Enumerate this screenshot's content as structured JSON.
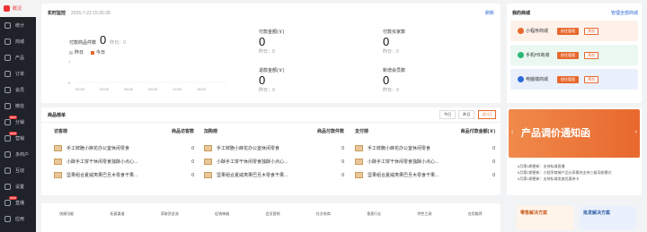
{
  "sidebar": {
    "items": [
      {
        "label": "概况",
        "active": true
      },
      {
        "label": "统计"
      },
      {
        "label": "商城"
      },
      {
        "label": "产品"
      },
      {
        "label": "订单"
      },
      {
        "label": "会员"
      },
      {
        "label": "微信"
      },
      {
        "label": "分销",
        "badge": "NEW"
      },
      {
        "label": "营销",
        "badge": "NEW"
      },
      {
        "label": "多商户"
      },
      {
        "label": "互动"
      },
      {
        "label": "设置"
      },
      {
        "label": "直播",
        "badge": "NEW"
      },
      {
        "label": "应用"
      }
    ]
  },
  "monitor": {
    "title": "实时监控",
    "timestamp": "2025-7-23 15:25:28",
    "refresh": "刷新",
    "paid_products_label": "付款商品件数",
    "paid_products_value": "0",
    "yesterday_label": "昨日：0",
    "legend_yesterday": "昨日",
    "legend_today": "今日",
    "y_ticks": [
      "1",
      "0"
    ],
    "x_ticks": [
      "00:00",
      "03:00",
      "06:00",
      "09:00",
      "12:00",
      "15:00"
    ],
    "stats": [
      {
        "label": "付款金额(￥)",
        "value": "0",
        "sub": "昨日：0"
      },
      {
        "label": "付款买家数",
        "value": "0",
        "sub": "昨日：0"
      },
      {
        "label": "退款金额(￥)",
        "value": "0",
        "sub": "昨日：0"
      },
      {
        "label": "新增会员数",
        "value": "0",
        "sub": "昨日：0"
      }
    ]
  },
  "ranking": {
    "title": "商品榜单",
    "filters": [
      "今日",
      "昨日",
      "近7日"
    ],
    "active_filter": "近7日",
    "columns": [
      {
        "title": "访客榜",
        "metric": "商品访客数",
        "rows": [
          {
            "name": "手工鲜脆小麻花办公室休闲零食",
            "value": "0"
          },
          {
            "name": "小酥手工饼干休闲零食独酥小点心...",
            "value": "0"
          },
          {
            "name": "坚果组合夏威夷果巴旦木零食干果...",
            "value": "0"
          }
        ]
      },
      {
        "title": "加购榜",
        "metric": "商品付款件数",
        "rows": [
          {
            "name": "手工鲜脆小麻花办公室休闲零食",
            "value": "0"
          },
          {
            "name": "小酥手工饼干休闲零食独酥小点心...",
            "value": "0"
          },
          {
            "name": "坚果组合夏威夷果巴旦木零食干果...",
            "value": "0"
          }
        ]
      },
      {
        "title": "支付榜",
        "metric": "商品付款金额(￥)",
        "rows": [
          {
            "name": "手工鲜脆小麻花办公室休闲零食",
            "value": "0"
          },
          {
            "name": "小酥手工饼干休闲零食独酥小点心...",
            "value": "0"
          },
          {
            "name": "坚果组合夏威夷果巴旦木零食干果...",
            "value": "0"
          }
        ]
      }
    ]
  },
  "bottom_tabs": [
    "快捷功能",
    "拓客渠道",
    "获取资金流",
    "促销神器",
    "会员营销",
    "社交电商",
    "垂直行业",
    "特色工具",
    "应用推荐"
  ],
  "stores": {
    "title": "我的商城",
    "manage": "管理全部商城",
    "items": [
      {
        "name": "小程序商城",
        "btn1": "前往管理",
        "btn2": "预览",
        "color": "#e8682d",
        "bg": "#fdf1ea"
      },
      {
        "name": "手机H5商城",
        "btn1": "前往管理",
        "btn2": "预览",
        "color": "#2bb673",
        "bg": "#eaf8f1"
      },
      {
        "name": "电脑端商城",
        "btn1": "前往管理",
        "btn2": "预览",
        "color": "#2d6ad6",
        "bg": "#eaf0fb"
      }
    ]
  },
  "banner": {
    "text": "产品调价通知函",
    "news": [
      "6月第3期更新：支持私域直播",
      "6月第2期更新：小程序商城产品分享模块支持三级导航模式",
      "6月第1期更新：支持私域发放优惠券卡"
    ]
  },
  "solutions": [
    "零售解决方案",
    "批发解决方案"
  ]
}
